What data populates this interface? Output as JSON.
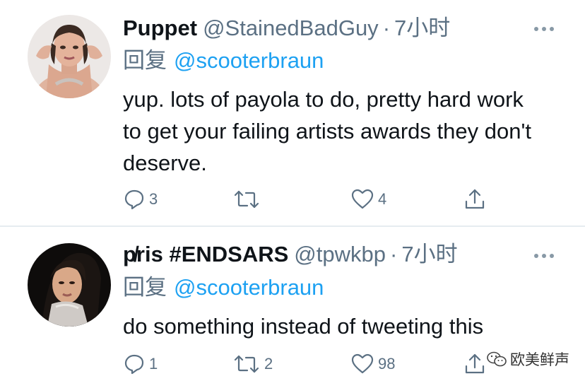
{
  "tweets": [
    {
      "display_name": "Puppet",
      "handle": "@StainedBadGuy",
      "separator": "·",
      "time": "7小时",
      "reply_prefix": "回复",
      "reply_to": "@scooterbraun",
      "text": "yup. lots of payola to do, pretty hard work to get your failing artists awards they don't deserve.",
      "reply_count": "3",
      "retweet_count": "",
      "like_count": "4"
    },
    {
      "display_name": "p̸ris #ENDSARS",
      "handle": "@tpwkbp",
      "separator": "·",
      "time": "7小时",
      "reply_prefix": "回复",
      "reply_to": "@scooterbraun",
      "text": "do something instead of tweeting this",
      "reply_count": "1",
      "retweet_count": "2",
      "like_count": "98"
    }
  ],
  "icons": {
    "reply": "comment-icon",
    "retweet": "retweet-icon",
    "like": "heart-icon",
    "share": "share-icon",
    "more": "more-dots-icon",
    "watermark": "wechat-icon"
  },
  "watermark": "欧美鲜声",
  "colors": {
    "text": "#0f1419",
    "secondary": "#5b7083",
    "link": "#1da1f2",
    "divider": "#e6ecf0"
  }
}
